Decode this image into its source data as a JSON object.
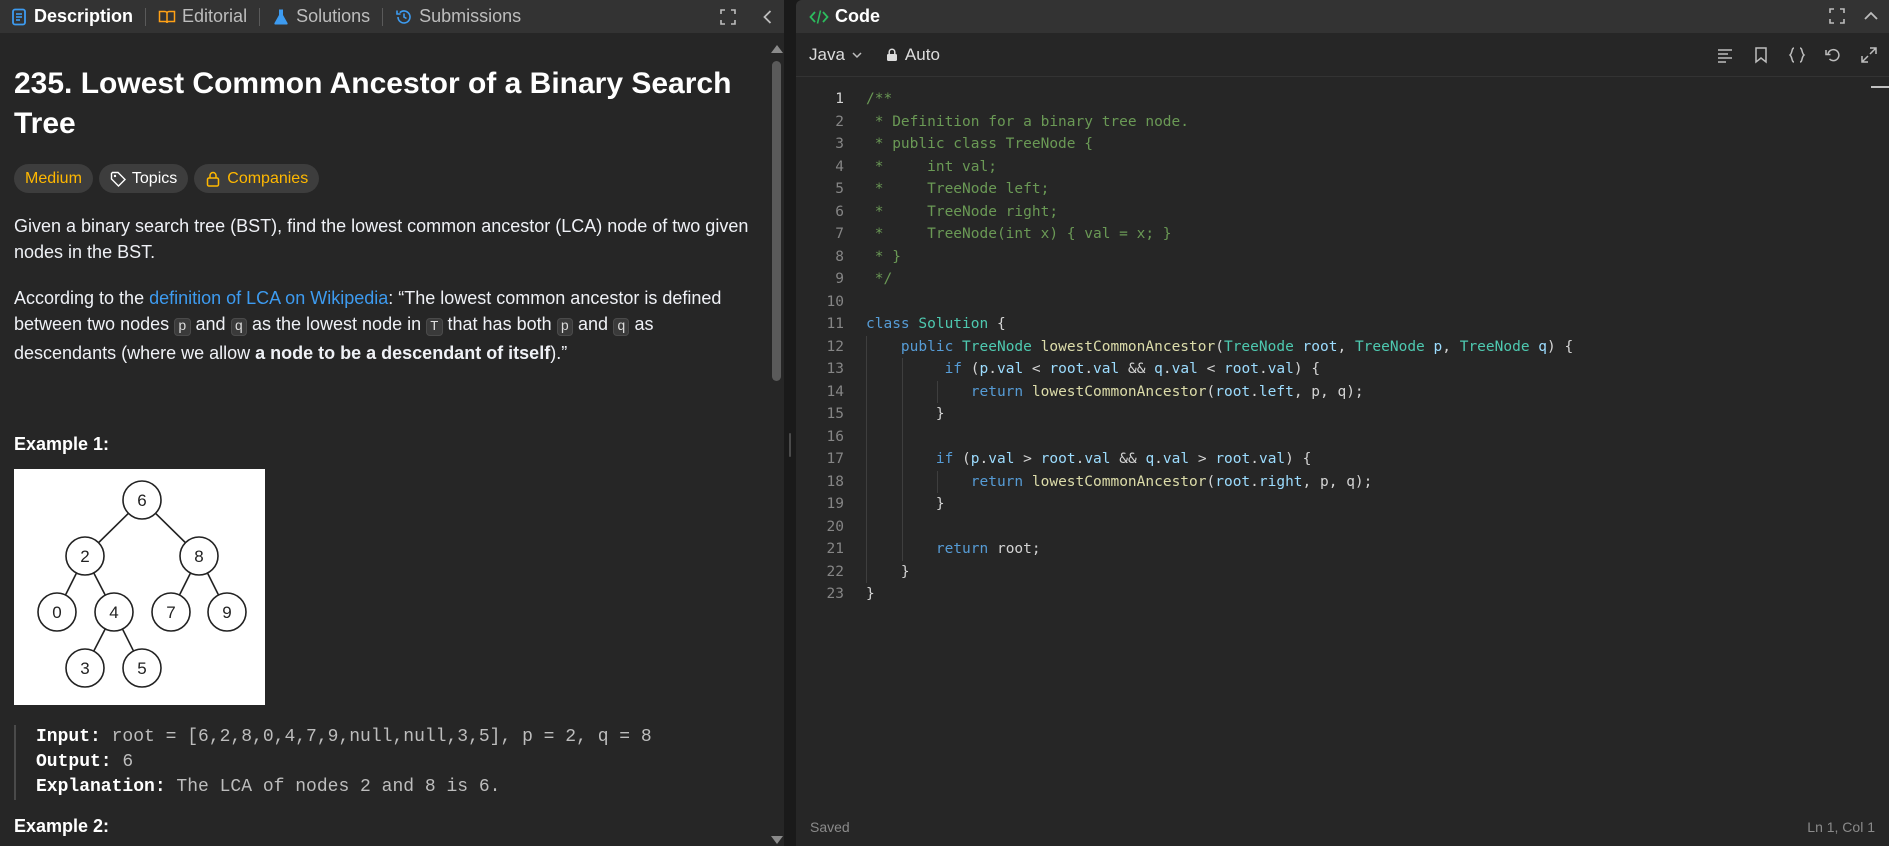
{
  "left_tabs": [
    {
      "label": "Description",
      "icon": "description-icon",
      "active": true
    },
    {
      "label": "Editorial",
      "icon": "book-icon",
      "active": false
    },
    {
      "label": "Solutions",
      "icon": "flask-icon",
      "active": false
    },
    {
      "label": "Submissions",
      "icon": "history-icon",
      "active": false
    }
  ],
  "problem": {
    "title": "235. Lowest Common Ancestor of a Binary Search Tree",
    "difficulty": "Medium",
    "topics_label": "Topics",
    "companies_label": "Companies",
    "para1": "Given a binary search tree (BST), find the lowest common ancestor (LCA) node of two given nodes in the BST.",
    "para2_prefix": "According to the ",
    "para2_link": "definition of LCA on Wikipedia",
    "para2_a": ": “The lowest common ancestor is defined between two nodes ",
    "para2_b": " and ",
    "para2_c": " as the lowest node in ",
    "para2_d": " that has both ",
    "para2_e": " and ",
    "para2_f": " as descendants (where we allow ",
    "para2_bold": "a node to be a descendant of itself",
    "para2_end": ").”",
    "code_p": "p",
    "code_q": "q",
    "code_T": "T",
    "example1_title": "Example 1:",
    "example1_tree": [
      "6",
      "2",
      "8",
      "0",
      "4",
      "7",
      "9",
      "3",
      "5"
    ],
    "input_label": "Input:",
    "input_value": " root = [6,2,8,0,4,7,9,null,null,3,5], p = 2, q = 8",
    "output_label": "Output:",
    "output_value": " 6",
    "explanation_label": "Explanation:",
    "explanation_value": " The LCA of nodes 2 and 8 is 6.",
    "example2_title": "Example 2:"
  },
  "code_panel": {
    "title": "Code",
    "language": "Java",
    "auto_label": "Auto",
    "status_left": "Saved",
    "status_right": "Ln 1, Col 1"
  },
  "code_lines": [
    {
      "n": "1",
      "indent": 0,
      "tokens": [
        [
          "cm",
          "/**"
        ]
      ]
    },
    {
      "n": "2",
      "indent": 0,
      "tokens": [
        [
          "cm",
          " * Definition for a binary tree node."
        ]
      ]
    },
    {
      "n": "3",
      "indent": 0,
      "tokens": [
        [
          "cm",
          " * public class TreeNode {"
        ]
      ]
    },
    {
      "n": "4",
      "indent": 0,
      "tokens": [
        [
          "cm",
          " *     int val;"
        ]
      ]
    },
    {
      "n": "5",
      "indent": 0,
      "tokens": [
        [
          "cm",
          " *     TreeNode left;"
        ]
      ]
    },
    {
      "n": "6",
      "indent": 0,
      "tokens": [
        [
          "cm",
          " *     TreeNode right;"
        ]
      ]
    },
    {
      "n": "7",
      "indent": 0,
      "tokens": [
        [
          "cm",
          " *     TreeNode(int x) { val = x; }"
        ]
      ]
    },
    {
      "n": "8",
      "indent": 0,
      "tokens": [
        [
          "cm",
          " * }"
        ]
      ]
    },
    {
      "n": "9",
      "indent": 0,
      "tokens": [
        [
          "cm",
          " */"
        ]
      ]
    },
    {
      "n": "10",
      "indent": 0,
      "tokens": []
    },
    {
      "n": "11",
      "indent": 0,
      "tokens": [
        [
          "kw",
          "class"
        ],
        [
          "pl",
          " "
        ],
        [
          "ty",
          "Solution"
        ],
        [
          "pl",
          " {"
        ]
      ]
    },
    {
      "n": "12",
      "indent": 1,
      "tokens": [
        [
          "pl",
          "    "
        ],
        [
          "kw",
          "public"
        ],
        [
          "pl",
          " "
        ],
        [
          "ty",
          "TreeNode"
        ],
        [
          "pl",
          " "
        ],
        [
          "fn",
          "lowestCommonAncestor"
        ],
        [
          "pl",
          "("
        ],
        [
          "ty",
          "TreeNode"
        ],
        [
          "pl",
          " "
        ],
        [
          "vr",
          "root"
        ],
        [
          "pl",
          ", "
        ],
        [
          "ty",
          "TreeNode"
        ],
        [
          "pl",
          " "
        ],
        [
          "vr",
          "p"
        ],
        [
          "pl",
          ", "
        ],
        [
          "ty",
          "TreeNode"
        ],
        [
          "pl",
          " "
        ],
        [
          "vr",
          "q"
        ],
        [
          "pl",
          ") {"
        ]
      ]
    },
    {
      "n": "13",
      "indent": 2,
      "tokens": [
        [
          "pl",
          "         "
        ],
        [
          "kw",
          "if"
        ],
        [
          "pl",
          " ("
        ],
        [
          "vr",
          "p"
        ],
        [
          "pl",
          "."
        ],
        [
          "vr",
          "val"
        ],
        [
          "pl",
          " < "
        ],
        [
          "vr",
          "root"
        ],
        [
          "pl",
          "."
        ],
        [
          "vr",
          "val"
        ],
        [
          "pl",
          " && "
        ],
        [
          "vr",
          "q"
        ],
        [
          "pl",
          "."
        ],
        [
          "vr",
          "val"
        ],
        [
          "pl",
          " < "
        ],
        [
          "vr",
          "root"
        ],
        [
          "pl",
          "."
        ],
        [
          "vr",
          "val"
        ],
        [
          "pl",
          ") {"
        ]
      ]
    },
    {
      "n": "14",
      "indent": 3,
      "tokens": [
        [
          "pl",
          "            "
        ],
        [
          "kw",
          "return"
        ],
        [
          "pl",
          " "
        ],
        [
          "fn",
          "lowestCommonAncestor"
        ],
        [
          "pl",
          "("
        ],
        [
          "vr",
          "root"
        ],
        [
          "pl",
          "."
        ],
        [
          "vr",
          "left"
        ],
        [
          "pl",
          ", p, q);"
        ]
      ]
    },
    {
      "n": "15",
      "indent": 2,
      "tokens": [
        [
          "pl",
          "        }"
        ]
      ]
    },
    {
      "n": "16",
      "indent": 2,
      "tokens": []
    },
    {
      "n": "17",
      "indent": 2,
      "tokens": [
        [
          "pl",
          "        "
        ],
        [
          "kw",
          "if"
        ],
        [
          "pl",
          " ("
        ],
        [
          "vr",
          "p"
        ],
        [
          "pl",
          "."
        ],
        [
          "vr",
          "val"
        ],
        [
          "pl",
          " > "
        ],
        [
          "vr",
          "root"
        ],
        [
          "pl",
          "."
        ],
        [
          "vr",
          "val"
        ],
        [
          "pl",
          " && "
        ],
        [
          "vr",
          "q"
        ],
        [
          "pl",
          "."
        ],
        [
          "vr",
          "val"
        ],
        [
          "pl",
          " > "
        ],
        [
          "vr",
          "root"
        ],
        [
          "pl",
          "."
        ],
        [
          "vr",
          "val"
        ],
        [
          "pl",
          ") {"
        ]
      ]
    },
    {
      "n": "18",
      "indent": 3,
      "tokens": [
        [
          "pl",
          "            "
        ],
        [
          "kw",
          "return"
        ],
        [
          "pl",
          " "
        ],
        [
          "fn",
          "lowestCommonAncestor"
        ],
        [
          "pl",
          "("
        ],
        [
          "vr",
          "root"
        ],
        [
          "pl",
          "."
        ],
        [
          "vr",
          "right"
        ],
        [
          "pl",
          ", p, q);"
        ]
      ]
    },
    {
      "n": "19",
      "indent": 2,
      "tokens": [
        [
          "pl",
          "        }"
        ]
      ]
    },
    {
      "n": "20",
      "indent": 2,
      "tokens": []
    },
    {
      "n": "21",
      "indent": 2,
      "tokens": [
        [
          "pl",
          "        "
        ],
        [
          "kw",
          "return"
        ],
        [
          "pl",
          " root;"
        ]
      ]
    },
    {
      "n": "22",
      "indent": 1,
      "tokens": [
        [
          "pl",
          "    }"
        ]
      ]
    },
    {
      "n": "23",
      "indent": 0,
      "tokens": [
        [
          "pl",
          "}"
        ]
      ]
    }
  ],
  "colors": {
    "accent_medium": "#ffb800",
    "link": "#3d9bf0",
    "code_tab_icon": "#2cbb5d"
  }
}
